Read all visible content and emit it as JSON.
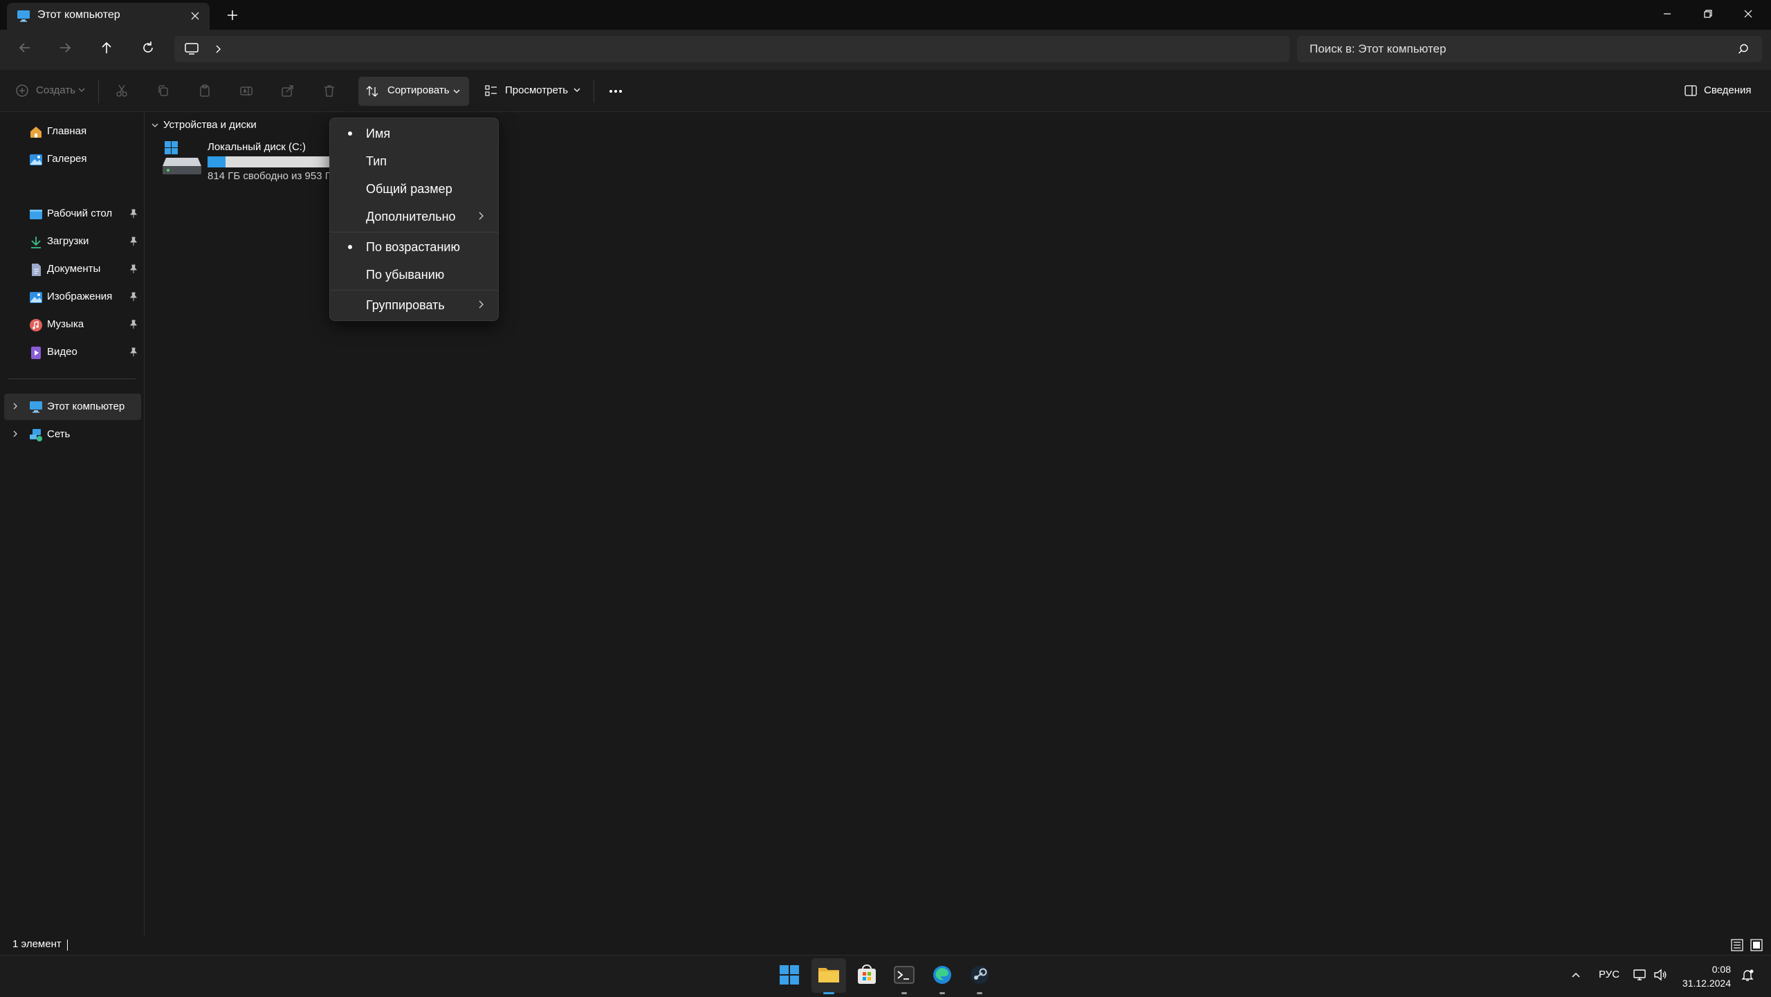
{
  "window": {
    "tab_title": "Этот компьютер",
    "new_tab_icon": "plus-icon",
    "controls": [
      "minimize-icon",
      "restore-icon",
      "close-icon"
    ]
  },
  "address_bar": {
    "location_icon": "computer-icon",
    "search_placeholder": "Поиск в: Этот компьютер"
  },
  "toolbar": {
    "create_label": "Создать",
    "sort_label": "Сортировать",
    "view_label": "Просмотреть",
    "details_label": "Сведения"
  },
  "sidebar": {
    "home": "Главная",
    "gallery": "Галерея",
    "quick_access": [
      {
        "label": "Рабочий стол",
        "icon": "desktop-folder-icon",
        "pinned": true
      },
      {
        "label": "Загрузки",
        "icon": "downloads-icon",
        "pinned": true
      },
      {
        "label": "Документы",
        "icon": "documents-icon",
        "pinned": true
      },
      {
        "label": "Изображения",
        "icon": "pictures-icon",
        "pinned": true
      },
      {
        "label": "Музыка",
        "icon": "music-icon",
        "pinned": true
      },
      {
        "label": "Видео",
        "icon": "videos-icon",
        "pinned": true
      }
    ],
    "this_pc": "Этот компьютер",
    "network": "Сеть"
  },
  "content": {
    "group_label": "Устройства и диски",
    "drive": {
      "name": "Локальный диск (C:)",
      "free_text": "814 ГБ свободно из 953 Г",
      "used_fraction": 0.146
    }
  },
  "sort_menu": {
    "items": [
      {
        "label": "Имя",
        "selected": true
      },
      {
        "label": "Тип",
        "selected": false
      },
      {
        "label": "Общий размер",
        "selected": false
      },
      {
        "label": "Дополнительно",
        "submenu": true
      }
    ],
    "order": [
      {
        "label": "По возрастанию",
        "selected": true
      },
      {
        "label": "По убыванию",
        "selected": false
      }
    ],
    "group": {
      "label": "Группировать",
      "submenu": true
    }
  },
  "status_bar": {
    "item_count": "1 элемент"
  },
  "taskbar": {
    "apps": [
      "start-icon",
      "file-explorer-icon",
      "store-icon",
      "terminal-icon",
      "edge-icon",
      "steam-icon"
    ],
    "language": "РУС",
    "time": "0:08",
    "date": "31.12.2024"
  },
  "colors": {
    "accent": "#2d9be6",
    "background": "#191919",
    "menu": "#2c2c2c"
  }
}
